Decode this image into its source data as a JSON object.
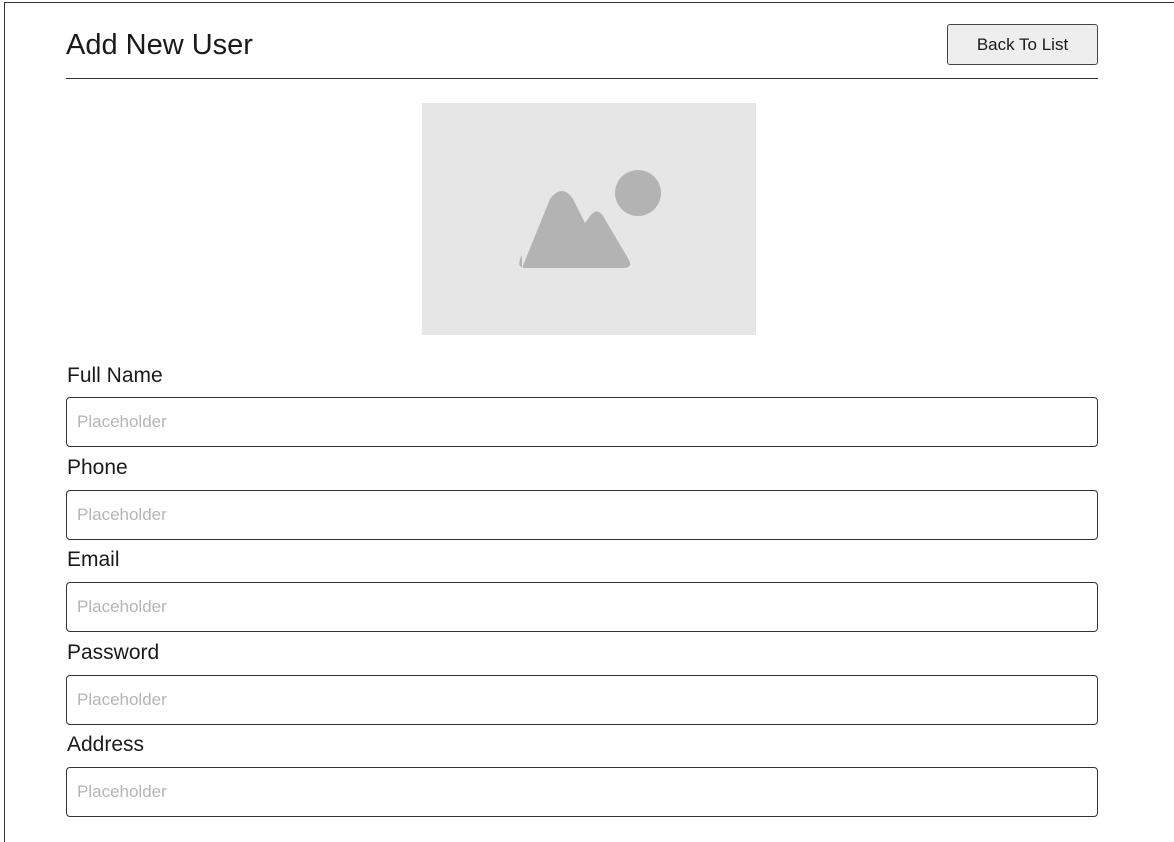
{
  "header": {
    "title": "Add New User",
    "back_label": "Back To List"
  },
  "image": {
    "icon": "image-placeholder-icon"
  },
  "form": {
    "fields": [
      {
        "label": "Full Name",
        "placeholder": "Placeholder",
        "value": ""
      },
      {
        "label": "Phone",
        "placeholder": "Placeholder",
        "value": ""
      },
      {
        "label": "Email",
        "placeholder": "Placeholder",
        "value": ""
      },
      {
        "label": "Password",
        "placeholder": "Placeholder",
        "value": ""
      },
      {
        "label": "Address",
        "placeholder": "Placeholder",
        "value": ""
      }
    ]
  },
  "colors": {
    "border": "#333333",
    "placeholder_bg": "#e6e6e6",
    "placeholder_icon": "#b3b3b3",
    "button_bg": "#eeeeee"
  }
}
